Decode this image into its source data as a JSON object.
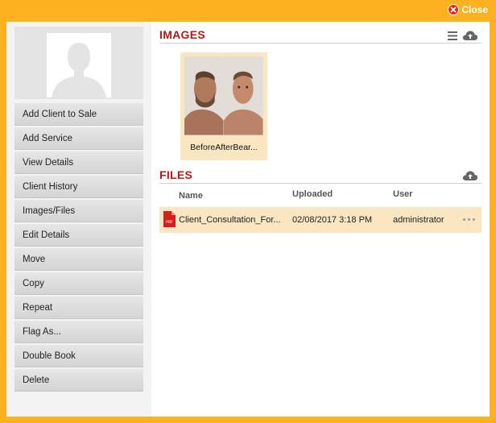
{
  "window": {
    "close_label": "Close"
  },
  "sidebar": {
    "items": [
      {
        "label": "Add Client to Sale"
      },
      {
        "label": "Add Service"
      },
      {
        "label": "View Details"
      },
      {
        "label": "Client History"
      },
      {
        "label": "Images/Files"
      },
      {
        "label": "Edit Details"
      },
      {
        "label": "Move"
      },
      {
        "label": "Copy"
      },
      {
        "label": "Repeat"
      },
      {
        "label": "Flag As..."
      },
      {
        "label": "Double Book"
      },
      {
        "label": "Delete"
      }
    ]
  },
  "images": {
    "title": "IMAGES",
    "items": [
      {
        "name": "BeforeAfterBear..."
      }
    ]
  },
  "files": {
    "title": "FILES",
    "columns": {
      "name": "Name",
      "uploaded": "Uploaded",
      "user": "User"
    },
    "rows": [
      {
        "name": "Client_Consultation_For...",
        "uploaded": "02/08/2017 3:18 PM",
        "user": "administrator"
      }
    ]
  },
  "colors": {
    "frame": "#fcb11f",
    "section_title": "#b11a1a",
    "selected_bg": "#fbe6c2"
  },
  "icons": [
    "close-icon",
    "list-view-icon",
    "cloud-upload-icon",
    "pdf-file-icon",
    "more-options-icon"
  ]
}
